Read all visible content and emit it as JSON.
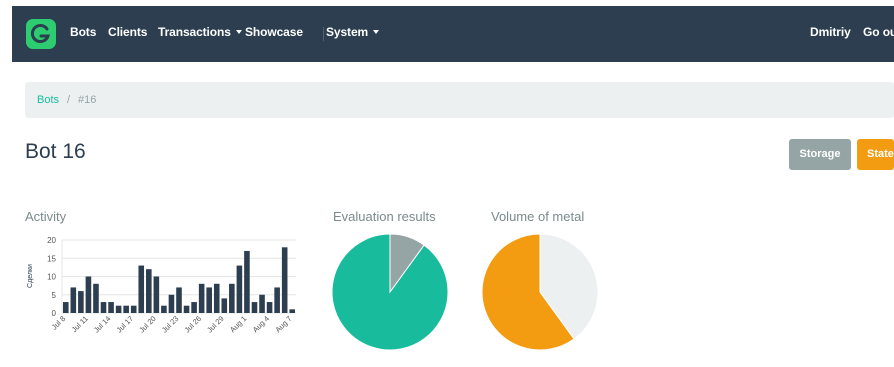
{
  "nav": {
    "items": [
      {
        "label": "Bots",
        "dropdown": false
      },
      {
        "label": "Clients",
        "dropdown": false
      },
      {
        "label": "Transactions",
        "dropdown": true
      },
      {
        "label": "Showcase",
        "dropdown": false
      },
      {
        "label": "System",
        "dropdown": true
      }
    ],
    "user": "Dmitriy",
    "logout": "Go out"
  },
  "breadcrumb": {
    "link": "Bots",
    "separator": "/",
    "current": "#16"
  },
  "page": {
    "title": "Bot 16",
    "buttons": {
      "storage": "Storage",
      "state": "State"
    }
  },
  "colors": {
    "navbar": "#2c3e50",
    "accent_green": "#18bc9c",
    "orange": "#f39c12",
    "gray": "#95a5a6",
    "light_gray": "#ecf0f1",
    "bar": "#2c3e50"
  },
  "sections": {
    "activity": "Activity",
    "evaluation": "Evaluation results",
    "volume": "Volume of metal"
  },
  "chart_data": [
    {
      "type": "bar",
      "title": "Activity",
      "ylabel": "Сделки",
      "ylim": [
        0,
        20
      ],
      "yticks": [
        0,
        5,
        10,
        15,
        20
      ],
      "xtick_labels": [
        "Jul 8",
        "Jul 11",
        "Jul 14",
        "Jul 17",
        "Jul 20",
        "Jul 23",
        "Jul 26",
        "Jul 29",
        "Aug 1",
        "Aug 4",
        "Aug 7"
      ],
      "xtick_every": 3,
      "grid": true,
      "values": [
        3,
        7,
        6,
        10,
        8,
        3,
        3,
        2,
        2,
        2,
        13,
        12,
        10,
        2,
        5,
        7,
        2,
        3,
        8,
        7,
        8,
        4,
        8,
        13,
        17,
        3,
        5,
        3,
        7,
        18,
        1
      ]
    },
    {
      "type": "pie",
      "title": "Evaluation results",
      "values": [
        90,
        10
      ],
      "colors": [
        "#18bc9c",
        "#95a5a6"
      ]
    },
    {
      "type": "pie",
      "title": "Volume of metal",
      "values": [
        60,
        40
      ],
      "colors": [
        "#f39c12",
        "#ecf0f1"
      ]
    }
  ]
}
